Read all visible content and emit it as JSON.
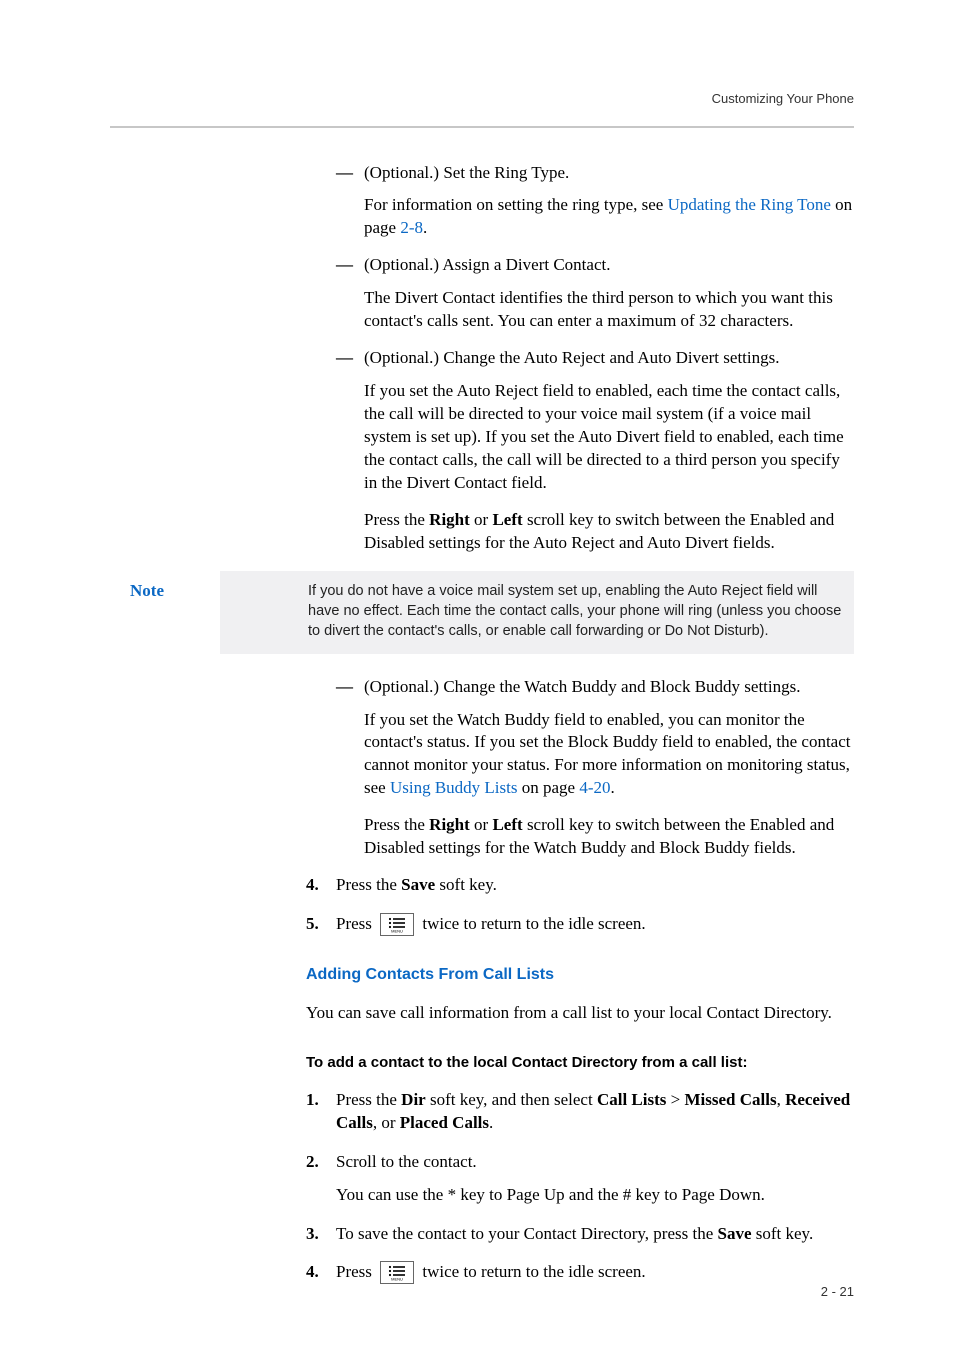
{
  "header": {
    "title": "Customizing Your Phone"
  },
  "subitems": [
    {
      "opt": "(Optional.) Set the Ring Type.",
      "body1a": "For information on setting the ring type, see ",
      "link1": "Updating the Ring Tone",
      "body1b": " on page ",
      "link2": "2-8",
      "body1c": "."
    },
    {
      "opt": "(Optional.) Assign a Divert Contact.",
      "body1": "The Divert Contact identifies the third person to which you want this contact's calls sent. You can enter a maximum of 32 characters."
    },
    {
      "opt": "(Optional.) Change the Auto Reject and Auto Divert settings.",
      "body1": "If you set the Auto Reject field to enabled, each time the contact calls, the call will be directed to your voice mail system (if a voice mail system is set up). If you set the Auto Divert field to enabled, each time the contact calls, the call will be directed to a third person you specify in the Divert Contact field.",
      "body2a": "Press the ",
      "body2b": " or ",
      "bold1": "Right",
      "bold2": "Left",
      "body2c": " scroll key to switch between the Enabled and Disabled settings for the Auto Reject and Auto Divert fields."
    }
  ],
  "note": {
    "label": "Note",
    "text": "If you do not have a voice mail system set up, enabling the Auto Reject field will have no effect. Each time the contact calls, your phone will ring (unless you choose to divert the contact's calls, or enable call forwarding or Do Not Disturb)."
  },
  "subitem4": {
    "opt": "(Optional.) Change the Watch Buddy and Block Buddy settings.",
    "body1a": "If you set the Watch Buddy field to enabled, you can monitor the contact's status. If you set the Block Buddy field to enabled, the contact cannot monitor your status. For more information on monitoring status, see ",
    "link1": "Using Buddy Lists",
    "body1b": " on page ",
    "link2": "4-20",
    "body1c": ".",
    "body2a": "Press the ",
    "bold1": "Right",
    "body2b": " or ",
    "bold2": "Left",
    "body2c": " scroll key to switch between the Enabled and Disabled settings for the Watch Buddy and Block Buddy fields."
  },
  "steps": {
    "step4": {
      "num": "4.",
      "a": "Press the ",
      "bold": "Save",
      "b": " soft key."
    },
    "step5": {
      "num": "5.",
      "a": "Press ",
      "b": " twice to return to the idle screen."
    }
  },
  "section2": {
    "heading": "Adding Contacts From Call Lists",
    "para": "You can save call information from a call list to your local Contact Directory.",
    "instr": "To add a contact to the local Contact Directory from a call list:",
    "s1": {
      "num": "1.",
      "a": "Press the ",
      "b1": "Dir",
      "c": " soft key, and then select ",
      "b2": "Call Lists",
      "d": " > ",
      "b3": "Missed Calls",
      "e": ", ",
      "b4": "Received Calls",
      "f": ", or ",
      "b5": "Placed Calls",
      "g": "."
    },
    "s2": {
      "num": "2.",
      "a": "Scroll to the contact.",
      "body": "You can use the * key to Page Up and the # key to Page Down."
    },
    "s3": {
      "num": "3.",
      "a": "To save the contact to your Contact Directory, press the ",
      "b1": "Save",
      "b": " soft key."
    },
    "s4": {
      "num": "4.",
      "a": "Press ",
      "b": " twice to return to the idle screen."
    }
  },
  "footer": {
    "page": "2 - 21"
  }
}
